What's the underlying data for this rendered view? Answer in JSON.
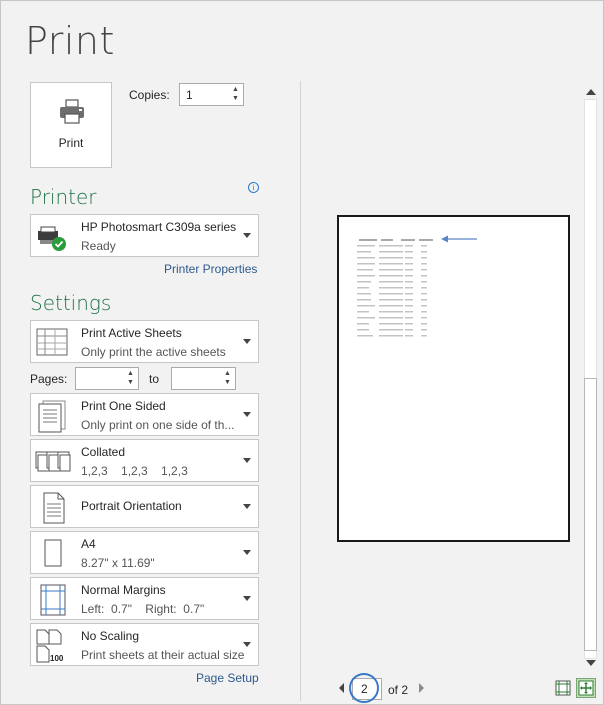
{
  "page": {
    "title": "Print"
  },
  "print_button": {
    "label": "Print"
  },
  "copies": {
    "label": "Copies:",
    "value": "1"
  },
  "printer": {
    "heading": "Printer",
    "name": "HP Photosmart C309a series",
    "status": "Ready",
    "properties_link": "Printer Properties"
  },
  "settings": {
    "heading": "Settings",
    "what": {
      "title": "Print Active Sheets",
      "sub": "Only print the active sheets"
    },
    "pages": {
      "label": "Pages:",
      "to_label": "to",
      "from": "",
      "to": ""
    },
    "sides": {
      "title": "Print One Sided",
      "sub": "Only print on one side of th..."
    },
    "collate": {
      "title": "Collated",
      "sub": "1,2,3    1,2,3    1,2,3"
    },
    "orientation": {
      "title": "Portrait Orientation"
    },
    "paper": {
      "title": "A4",
      "sub": "8.27\" x 11.69\""
    },
    "margins": {
      "title": "Normal Margins",
      "sub": "Left:  0.7\"    Right:  0.7\""
    },
    "scaling": {
      "title": "No Scaling",
      "sub": "Print sheets at their actual size",
      "icon_text": "100"
    },
    "page_setup_link": "Page Setup"
  },
  "preview_nav": {
    "current_page": "2",
    "of_label": "of 2"
  },
  "colors": {
    "accent_green": "#217346",
    "link_blue": "#2e5a8c",
    "highlight_ring": "#3a79c8"
  }
}
